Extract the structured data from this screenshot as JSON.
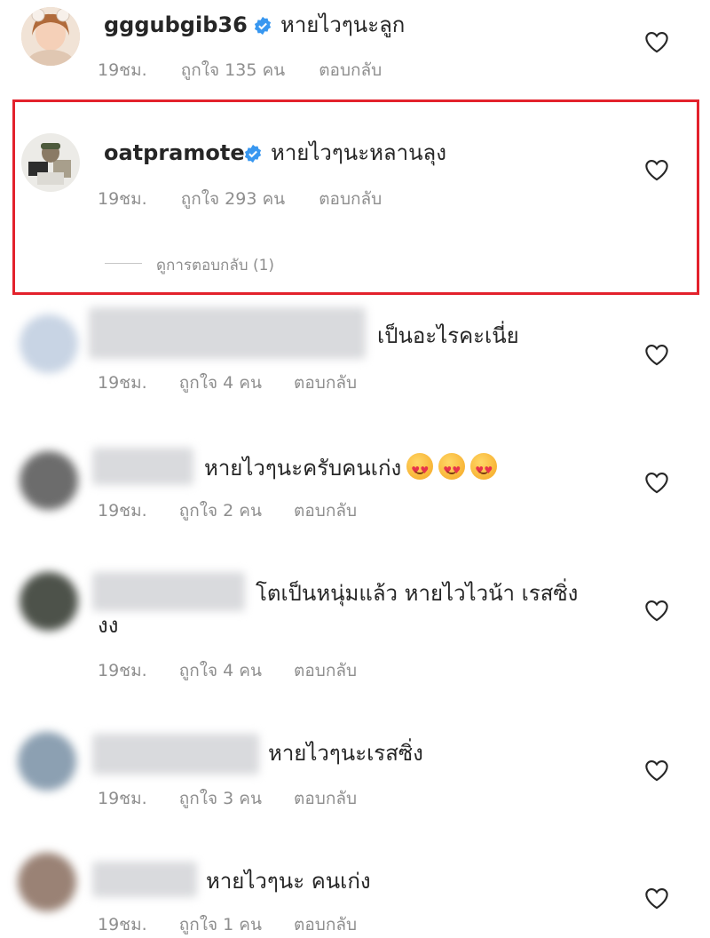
{
  "comments": [
    {
      "username": "gggubgib36",
      "verified": true,
      "text": "หายไวๆนะลูก",
      "time": "19ชม.",
      "likes": "ถูกใจ 135 คน",
      "reply": "ตอบกลับ"
    },
    {
      "username": "oatpramote",
      "verified": true,
      "text": "หายไวๆนะหลานลุง",
      "time": "19ชม.",
      "likes": "ถูกใจ 293 คน",
      "reply": "ตอบกลับ",
      "view_replies": "ดูการตอบกลับ (1)"
    },
    {
      "text": "เป็นอะไรคะเนี่ย",
      "time": "19ชม.",
      "likes": "ถูกใจ 4 คน",
      "reply": "ตอบกลับ"
    },
    {
      "text": "หายไวๆนะครับคนเก่ง",
      "time": "19ชม.",
      "likes": "ถูกใจ 2 คน",
      "reply": "ตอบกลับ",
      "emoji": "heart-eyes-emoji"
    },
    {
      "text": "โตเป็นหนุ่มแล้ว หายไวไวน้า เรสซิ่ง",
      "text_line2": "งง",
      "time": "19ชม.",
      "likes": "ถูกใจ 4 คน",
      "reply": "ตอบกลับ"
    },
    {
      "text": "หายไวๆนะเรสซิ่ง",
      "time": "19ชม.",
      "likes": "ถูกใจ 3 คน",
      "reply": "ตอบกลับ"
    },
    {
      "text": "หายไวๆนะ คนเก่ง",
      "time": "19ชม.",
      "likes": "ถูกใจ 1 คน",
      "reply": "ตอบกลับ"
    }
  ],
  "icons": {
    "like": "heart-outline-icon",
    "verified": "verified-badge-icon"
  },
  "colors": {
    "highlight": "#e3222c",
    "verified": "#3897f0",
    "meta": "#8e8e8e"
  }
}
